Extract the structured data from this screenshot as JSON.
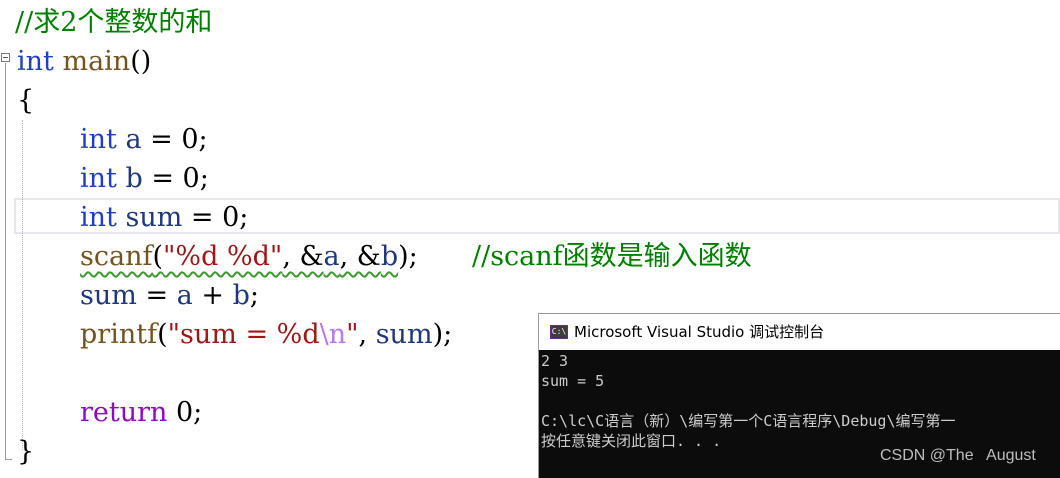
{
  "editor": {
    "comment_top": "//求2个整数的和",
    "lines": {
      "main_kw": "int",
      "main_name": "main",
      "main_parens": "()",
      "open_brace": "{",
      "l_a_kw": "int",
      "l_a_var": "a",
      "l_a_rest": " = 0;",
      "l_b_kw": "int",
      "l_b_var": "b",
      "l_b_rest": " = 0;",
      "l_sum_kw": "int",
      "l_sum_var": "sum",
      "l_sum_rest": " = 0;",
      "scanf_fn": "scanf",
      "scanf_open": "(",
      "scanf_fmt": "\"%d %d\"",
      "scanf_args_sep1": ", &",
      "scanf_arg_a": "a",
      "scanf_args_sep2": ", &",
      "scanf_arg_b": "b",
      "scanf_close": ");",
      "scanf_comment": "//scanf函数是输入函数",
      "assign_sum": "sum",
      "assign_eq": " = ",
      "assign_a": "a",
      "assign_plus": " + ",
      "assign_b": "b",
      "assign_end": ";",
      "printf_fn": "printf",
      "printf_open": "(",
      "printf_fmt_pre": "\"sum = %d",
      "printf_esc": "\\n",
      "printf_fmt_post": "\"",
      "printf_sep": ", ",
      "printf_sum": "sum",
      "printf_close": ");",
      "return_kw": "return",
      "return_rest": " 0;",
      "close_brace": "}"
    }
  },
  "console": {
    "icon_label": "C:\\",
    "title": "Microsoft Visual Studio 调试控制台",
    "output": [
      "2 3",
      "sum = 5",
      "",
      "C:\\lc\\C语言（新）\\编写第一个C语言程序\\Debug\\编写第一",
      "按任意键关闭此窗口. . ."
    ]
  },
  "watermark": "CSDN @The   August",
  "colors": {
    "keyword": "#1f3ec7",
    "function": "#74531f",
    "variable": "#1f377f",
    "string": "#a31515",
    "escape": "#b776fb",
    "comment": "#008000",
    "return_keyword": "#8f08c4",
    "squiggle": "#3c9a2e",
    "console_bg": "#0c0c0c",
    "console_text": "#cccccc"
  }
}
